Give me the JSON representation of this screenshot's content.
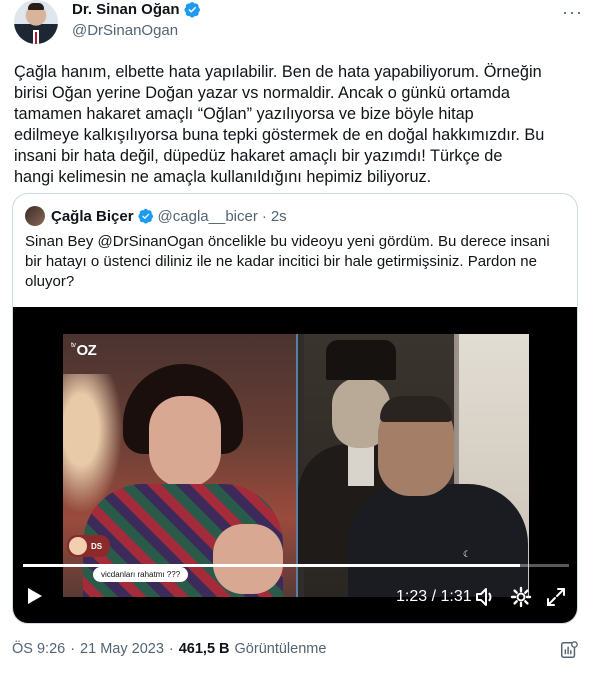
{
  "author": {
    "name": "Dr. Sinan Oğan",
    "handle": "@DrSinanOgan",
    "verified_icon": "verified-badge-icon",
    "more_label": "···"
  },
  "tweet": {
    "text": "Çağla hanım, elbette hata yapılabilir. Ben de hata yapabiliyorum. Örneğin\nbirisi Oğan yerine Doğan yazar vs normaldir. Ancak o günkü ortamda\ntamamen hakaret amaçlı “Oğlan” yazılıyorsa ve bize böyle hitap\nedilmeye kalkışılıyorsa buna tepki göstermek de en doğal hakkımızdır. Bu\ninsani bir hata değil, düpedüz hakaret amaçlı bir yazımdı! Türkçe de\nhangi kelimesin ne amaçla kullanıldığını hepimiz biliyoruz."
  },
  "quote": {
    "name": "Çağla Biçer",
    "handle": "@cagla__bicer",
    "dot": "·",
    "time": "2s",
    "text": "Sinan Bey @DrSinanOgan öncelikle bu videoyu yeni gördüm. Bu derece insani\nbir hatayı o üstenci diliniz ile ne kadar incitici bir hale getirmişsiniz. Pardon ne\noluyor?"
  },
  "video": {
    "channel_logo_small": "tv",
    "channel_logo": "OZ",
    "ds_label": "DS",
    "comment": "vicdanları rahatmı ???",
    "time_display": "1:23 / 1:31",
    "progress": 0.91,
    "icons": [
      "play-icon",
      "volume-icon",
      "settings-gear-icon",
      "fullscreen-icon"
    ]
  },
  "meta": {
    "time": "ÖS 9:26",
    "sep1": "·",
    "date": "21 May 2023",
    "sep2": "·",
    "views_count": "461,5 B",
    "views_label": "Görüntülenme"
  },
  "colors": {
    "accent": "#1d9bf0",
    "secondary_text": "#536471",
    "border": "#cfd9de"
  }
}
